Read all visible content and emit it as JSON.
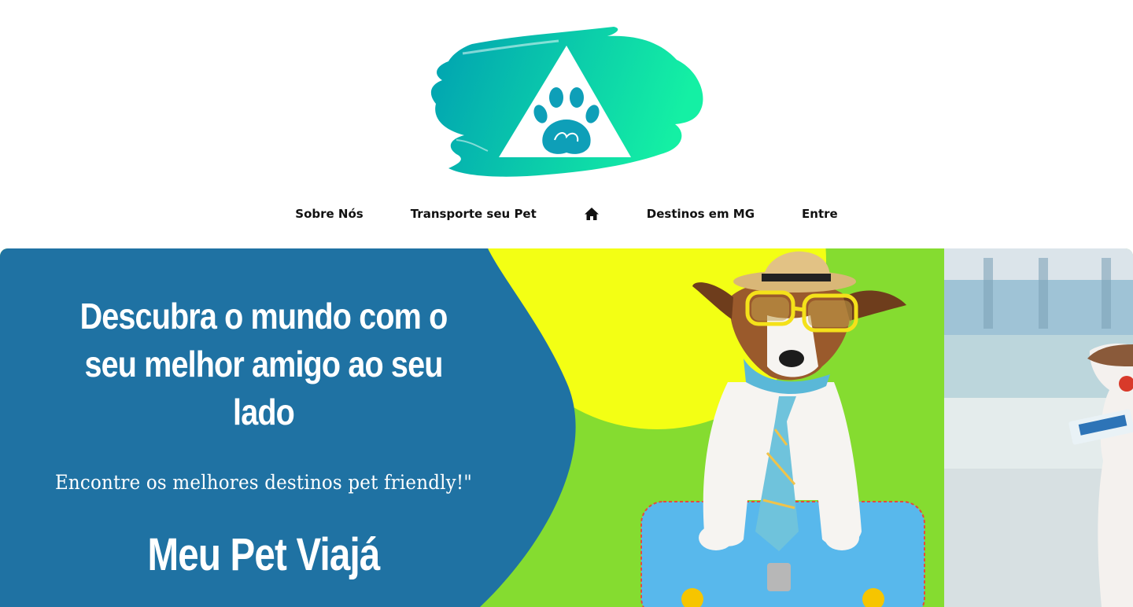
{
  "header": {
    "logo_name": "paw-triangle-logo",
    "nav": [
      {
        "label": "Sobre Nós"
      },
      {
        "label": "Transporte seu Pet"
      },
      {
        "label": "",
        "icon": "home-icon"
      },
      {
        "label": "Destinos em MG"
      },
      {
        "label": "Entre"
      }
    ]
  },
  "hero": {
    "title": "Descubra o mundo com o seu melhor amigo ao seu lado",
    "subtitle": "Encontre os melhores destinos pet friendly!\"",
    "brand": "Meu Pet Viajá"
  },
  "colors": {
    "hero_blue": "#1f72a3",
    "hero_green": "#85dc30",
    "hero_yellow": "#f3ff14",
    "logo_gradient_start": "#00a5b5",
    "logo_gradient_end": "#12eea5",
    "nav_text": "#111111"
  }
}
